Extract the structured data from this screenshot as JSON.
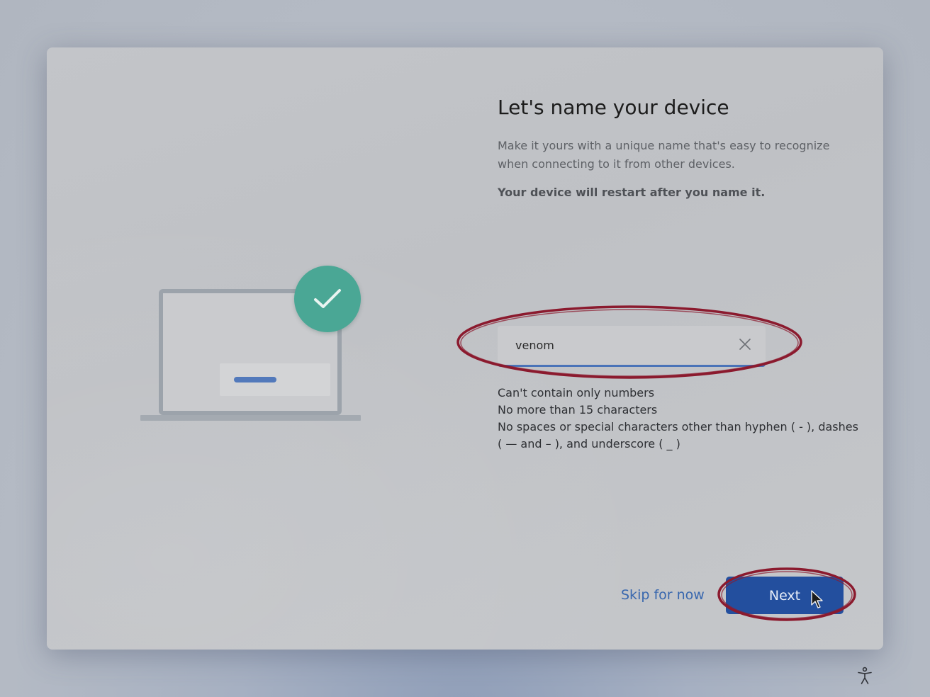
{
  "dialog": {
    "title": "Let's name your device",
    "description": "Make it yours with a unique name that's easy to recognize when connecting to it from other devices.",
    "warning": "Your device will restart after you name it."
  },
  "name_input": {
    "value": "venom",
    "clear_icon": "close-icon"
  },
  "rules": [
    "Can't contain only numbers",
    "No more than 15 characters",
    "No spaces or special characters other than hyphen ( - ), dashes ( — and – ), and underscore ( _ )"
  ],
  "actions": {
    "skip_label": "Skip for now",
    "next_label": "Next"
  },
  "illustration": {
    "device_icon": "laptop-icon",
    "badge_icon": "checkmark-icon"
  },
  "colors": {
    "accent": "#234f9e",
    "link": "#3867ae",
    "badge": "#4aa795",
    "annotation": "#8b1a2e"
  },
  "footer": {
    "accessibility_icon": "accessibility-icon"
  }
}
